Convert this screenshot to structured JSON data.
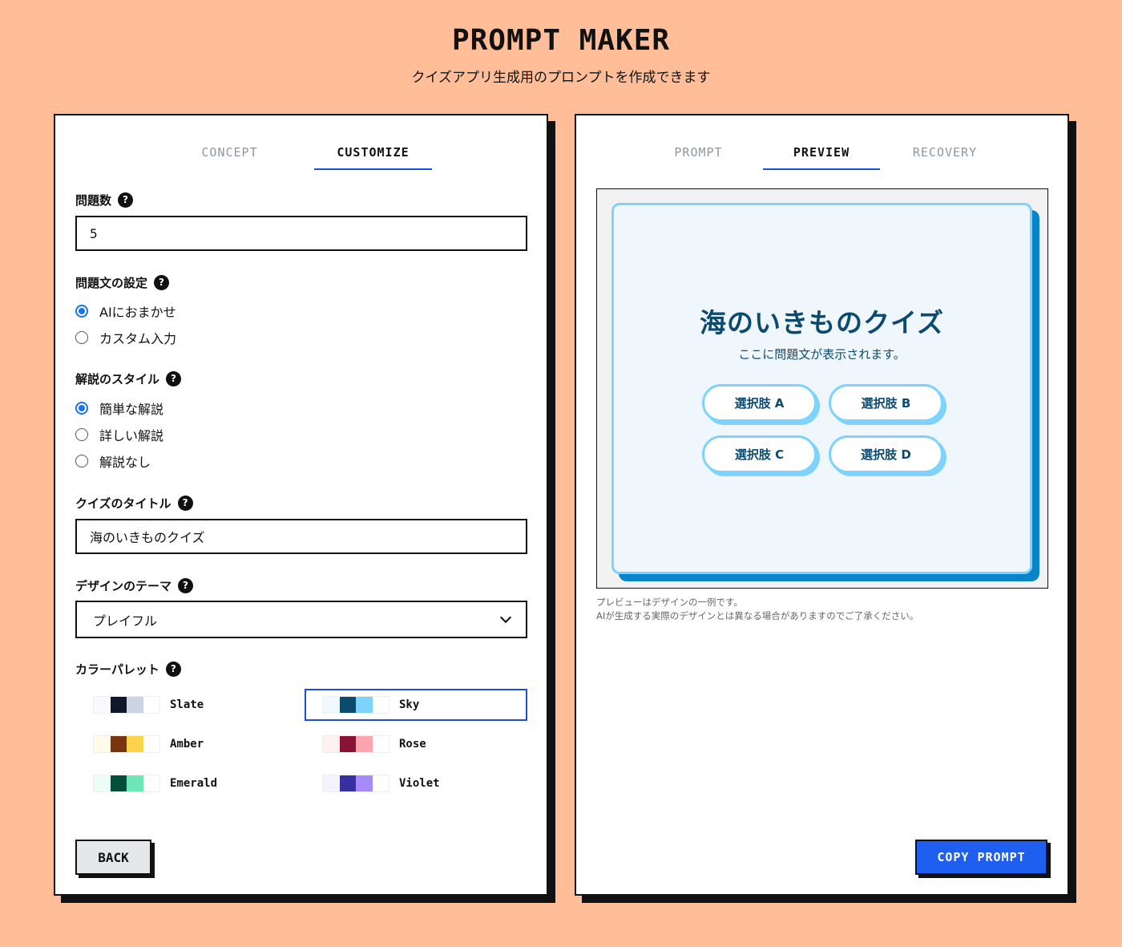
{
  "header": {
    "title": "PROMPT MAKER",
    "subtitle": "クイズアプリ生成用のプロンプトを作成できます"
  },
  "left_panel": {
    "tabs": [
      {
        "label": "CONCEPT",
        "active": false
      },
      {
        "label": "CUSTOMIZE",
        "active": true
      }
    ],
    "question_count": {
      "label": "問題数",
      "help": "?",
      "value": "5"
    },
    "question_text_setting": {
      "label": "問題文の設定",
      "help": "?",
      "options": [
        {
          "label": "AIにおまかせ",
          "checked": true
        },
        {
          "label": "カスタム入力",
          "checked": false
        }
      ]
    },
    "explanation_style": {
      "label": "解説のスタイル",
      "help": "?",
      "options": [
        {
          "label": "簡単な解説",
          "checked": true
        },
        {
          "label": "詳しい解説",
          "checked": false
        },
        {
          "label": "解説なし",
          "checked": false
        }
      ]
    },
    "quiz_title": {
      "label": "クイズのタイトル",
      "help": "?",
      "value": "海のいきものクイズ"
    },
    "design_theme": {
      "label": "デザインのテーマ",
      "help": "?",
      "selected": "プレイフル"
    },
    "color_palette": {
      "label": "カラーパレット",
      "help": "?",
      "selected": "Sky",
      "items": [
        {
          "name": "Slate",
          "colors": [
            "#f8fafc",
            "#0f172a",
            "#cbd5e1",
            "#ffffff"
          ]
        },
        {
          "name": "Sky",
          "colors": [
            "#f0f9ff",
            "#0c4a6e",
            "#7dd3fc",
            "#ffffff"
          ]
        },
        {
          "name": "Amber",
          "colors": [
            "#fffbeb",
            "#78350f",
            "#fcd34d",
            "#ffffff"
          ]
        },
        {
          "name": "Rose",
          "colors": [
            "#fff1f2",
            "#881337",
            "#fda4af",
            "#ffffff"
          ]
        },
        {
          "name": "Emerald",
          "colors": [
            "#ecfdf5",
            "#064e3b",
            "#6ee7b7",
            "#ffffff"
          ]
        },
        {
          "name": "Violet",
          "colors": [
            "#f5f3ff",
            "#3730a3",
            "#a78bfa",
            "#ffffff"
          ]
        }
      ]
    },
    "back_label": "BACK"
  },
  "right_panel": {
    "tabs": [
      {
        "label": "PROMPT",
        "active": false
      },
      {
        "label": "PREVIEW",
        "active": true
      },
      {
        "label": "RECOVERY",
        "active": false
      }
    ],
    "preview": {
      "title": "海のいきものクイズ",
      "question": "ここに問題文が表示されます。",
      "choices": [
        "選択肢 A",
        "選択肢 B",
        "選択肢 C",
        "選択肢 D"
      ]
    },
    "note_line1": "プレビューはデザインの一例です。",
    "note_line2": "AIが生成する実際のデザインとは異なる場合がありますのでご了承ください。",
    "copy_label": "COPY PROMPT"
  },
  "colors": {
    "background": "#ffbe98",
    "accent_blue": "#1d4ed8",
    "copy_button": "#1f5ff0",
    "preview_border": "#7dd3fc",
    "preview_text": "#0c4a6e"
  }
}
